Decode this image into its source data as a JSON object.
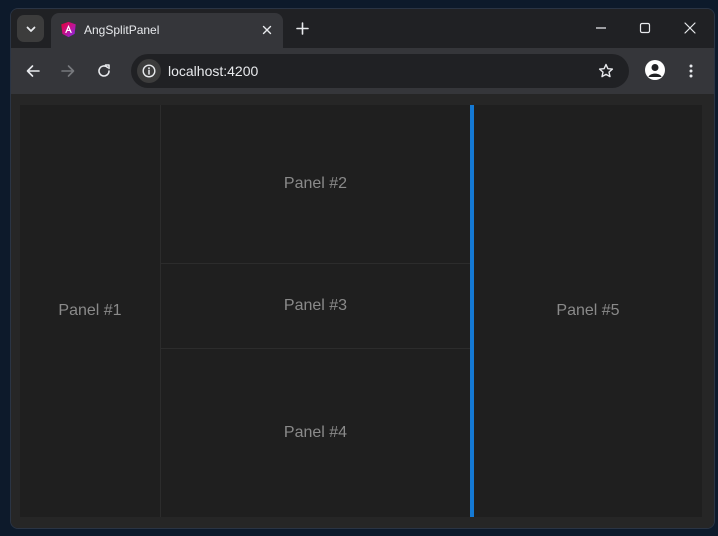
{
  "browser": {
    "tab": {
      "title": "AngSplitPanel",
      "favicon": "angular-icon"
    },
    "address_bar": {
      "url": "localhost:4200"
    },
    "accent_color": "#1479d4"
  },
  "app": {
    "panels": [
      {
        "label": "Panel #1"
      },
      {
        "label": "Panel #2"
      },
      {
        "label": "Panel #3"
      },
      {
        "label": "Panel #4"
      },
      {
        "label": "Panel #5"
      }
    ]
  }
}
